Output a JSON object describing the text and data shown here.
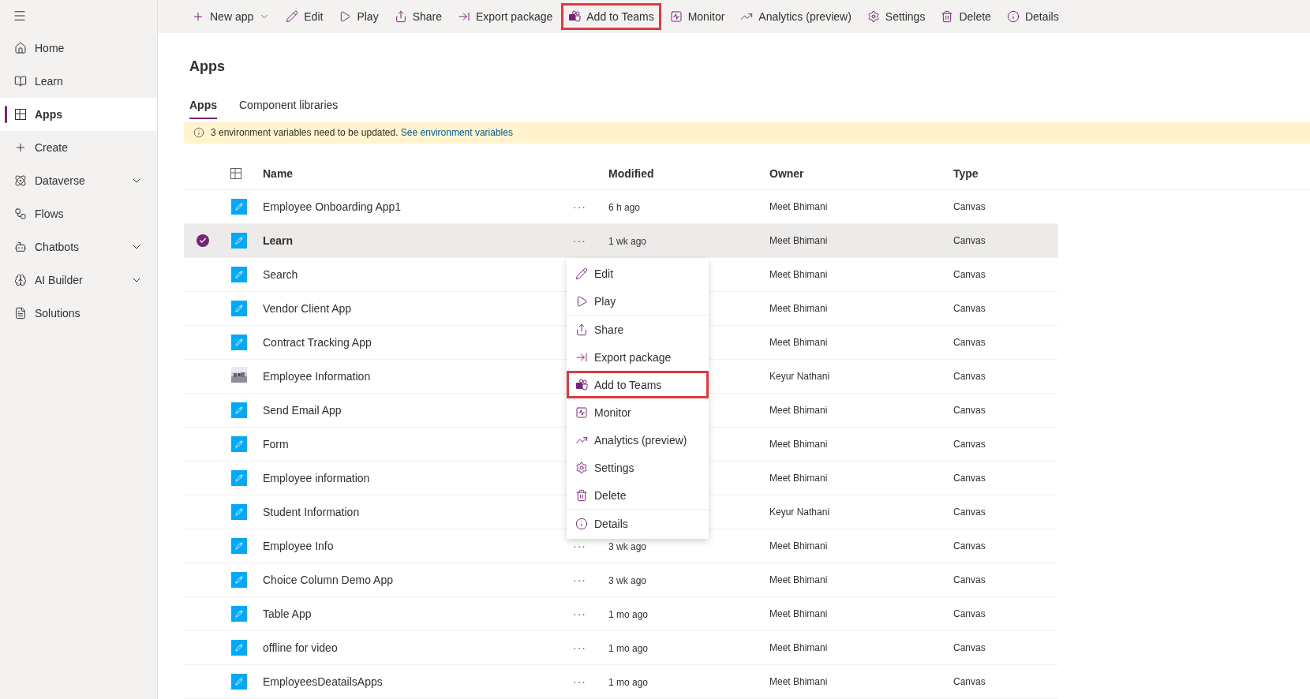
{
  "sidebar": {
    "items": [
      {
        "label": "Home",
        "selected": false
      },
      {
        "label": "Learn",
        "selected": false
      },
      {
        "label": "Apps",
        "selected": true
      },
      {
        "label": "Create",
        "selected": false
      },
      {
        "label": "Dataverse",
        "selected": false,
        "expandable": true
      },
      {
        "label": "Flows",
        "selected": false
      },
      {
        "label": "Chatbots",
        "selected": false,
        "expandable": true
      },
      {
        "label": "AI Builder",
        "selected": false,
        "expandable": true
      },
      {
        "label": "Solutions",
        "selected": false
      }
    ]
  },
  "toolbar": {
    "items": [
      {
        "label": "New app",
        "dropdown": true,
        "highlighted": false
      },
      {
        "label": "Edit",
        "highlighted": false
      },
      {
        "label": "Play",
        "highlighted": false
      },
      {
        "label": "Share",
        "highlighted": false
      },
      {
        "label": "Export package",
        "highlighted": false
      },
      {
        "label": "Add to Teams",
        "highlighted": true
      },
      {
        "label": "Monitor",
        "highlighted": false
      },
      {
        "label": "Analytics (preview)",
        "highlighted": false
      },
      {
        "label": "Settings",
        "highlighted": false
      },
      {
        "label": "Delete",
        "highlighted": false
      },
      {
        "label": "Details",
        "highlighted": false
      }
    ]
  },
  "page_title": "Apps",
  "tabs": [
    {
      "label": "Apps",
      "selected": true
    },
    {
      "label": "Component libraries",
      "selected": false
    }
  ],
  "banner": {
    "text": "3 environment variables need to be updated.",
    "link": "See environment variables"
  },
  "table": {
    "columns": [
      "Name",
      "Modified",
      "Owner",
      "Type"
    ],
    "rows": [
      {
        "name": "Employee Onboarding App1",
        "more": "···",
        "modified": "6 h ago",
        "owner": "Meet Bhimani",
        "type": "Canvas",
        "selected": false,
        "kind": "app"
      },
      {
        "name": "Learn",
        "more": "···",
        "modified": "1 wk ago",
        "owner": "Meet Bhimani",
        "type": "Canvas",
        "selected": true,
        "kind": "app"
      },
      {
        "name": "Search",
        "owner": "Meet Bhimani",
        "type": "Canvas",
        "selected": false,
        "kind": "app"
      },
      {
        "name": "Vendor Client App",
        "owner": "Meet Bhimani",
        "type": "Canvas",
        "selected": false,
        "kind": "app"
      },
      {
        "name": "Contract Tracking App",
        "owner": "Meet Bhimani",
        "type": "Canvas",
        "selected": false,
        "kind": "app"
      },
      {
        "name": "Employee Information",
        "owner": "Keyur Nathani",
        "type": "Canvas",
        "selected": false,
        "kind": "picture"
      },
      {
        "name": "Send Email App",
        "owner": "Meet Bhimani",
        "type": "Canvas",
        "selected": false,
        "kind": "app"
      },
      {
        "name": "Form",
        "owner": "Meet Bhimani",
        "type": "Canvas",
        "selected": false,
        "kind": "app"
      },
      {
        "name": "Employee information",
        "owner": "Meet Bhimani",
        "type": "Canvas",
        "selected": false,
        "kind": "app"
      },
      {
        "name": "Student Information",
        "owner": "Keyur Nathani",
        "type": "Canvas",
        "selected": false,
        "kind": "app"
      },
      {
        "name": "Employee Info",
        "more": "···",
        "modified": "3 wk ago",
        "owner": "Meet Bhimani",
        "type": "Canvas",
        "selected": false,
        "kind": "app"
      },
      {
        "name": "Choice Column Demo App",
        "more": "···",
        "modified": "3 wk ago",
        "owner": "Meet Bhimani",
        "type": "Canvas",
        "selected": false,
        "kind": "app"
      },
      {
        "name": "Table App",
        "more": "···",
        "modified": "1 mo ago",
        "owner": "Meet Bhimani",
        "type": "Canvas",
        "selected": false,
        "kind": "app"
      },
      {
        "name": "offline for video",
        "more": "···",
        "modified": "1 mo ago",
        "owner": "Meet Bhimani",
        "type": "Canvas",
        "selected": false,
        "kind": "app"
      },
      {
        "name": "EmployeesDeatailsApps",
        "more": "···",
        "modified": "1 mo ago",
        "owner": "Meet Bhimani",
        "type": "Canvas",
        "selected": false,
        "kind": "app"
      }
    ]
  },
  "context_menu": {
    "items": [
      {
        "kind": "item",
        "label": "Edit",
        "highlighted": false
      },
      {
        "kind": "item",
        "label": "Play",
        "highlighted": false
      },
      {
        "kind": "divider"
      },
      {
        "kind": "item",
        "label": "Share",
        "highlighted": false
      },
      {
        "kind": "item",
        "label": "Export package",
        "highlighted": false
      },
      {
        "kind": "item",
        "label": "Add to Teams",
        "highlighted": true
      },
      {
        "kind": "item",
        "label": "Monitor",
        "highlighted": false
      },
      {
        "kind": "item",
        "label": "Analytics (preview)",
        "highlighted": false
      },
      {
        "kind": "item",
        "label": "Settings",
        "highlighted": false
      },
      {
        "kind": "item",
        "label": "Delete",
        "highlighted": false
      },
      {
        "kind": "divider"
      },
      {
        "kind": "item",
        "label": "Details",
        "highlighted": false
      }
    ]
  }
}
